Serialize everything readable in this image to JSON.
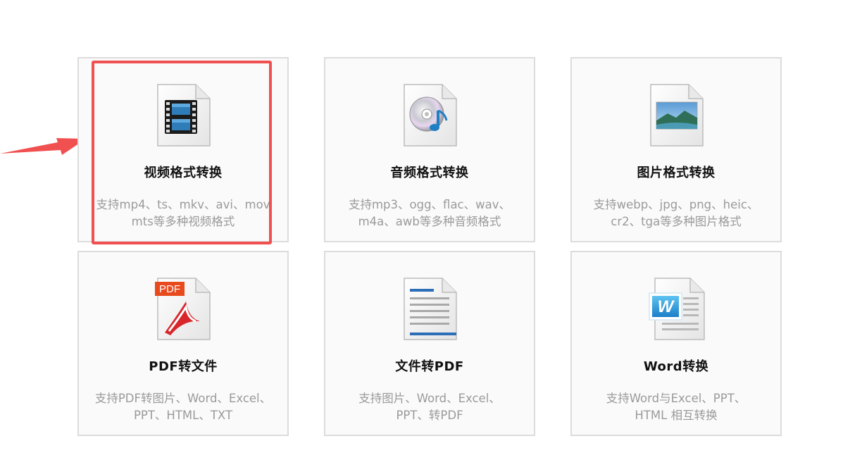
{
  "colors": {
    "highlight": "#f05050",
    "card_border": "#dcdcdc",
    "card_bg": "#fafafa",
    "title": "#111111",
    "desc": "#9a9a9a"
  },
  "cards": [
    {
      "icon": "video-file-icon",
      "title": "视频格式转换",
      "desc_line1": "支持mp4、ts、mkv、avi、mov",
      "desc_line2": "mts等多种视频格式",
      "highlighted": true
    },
    {
      "icon": "audio-file-icon",
      "title": "音频格式转换",
      "desc_line1": "支持mp3、ogg、flac、wav、",
      "desc_line2": "m4a、awb等多种音频格式"
    },
    {
      "icon": "image-file-icon",
      "title": "图片格式转换",
      "desc_line1": "支持webp、jpg、png、heic、",
      "desc_line2": "cr2、tga等多种图片格式"
    },
    {
      "icon": "pdf-file-icon",
      "icon_label": "PDF",
      "title": "PDF转文件",
      "desc_line1": "支持PDF转图片、Word、Excel、",
      "desc_line2": "PPT、HTML、TXT"
    },
    {
      "icon": "document-file-icon",
      "title": "文件转PDF",
      "desc_line1": "支持图片、Word、Excel、",
      "desc_line2": "PPT、转PDF"
    },
    {
      "icon": "word-file-icon",
      "icon_label": "W",
      "title": "Word转换",
      "desc_line1": "支持Word与Excel、PPT、",
      "desc_line2": "HTML 相互转换"
    }
  ]
}
